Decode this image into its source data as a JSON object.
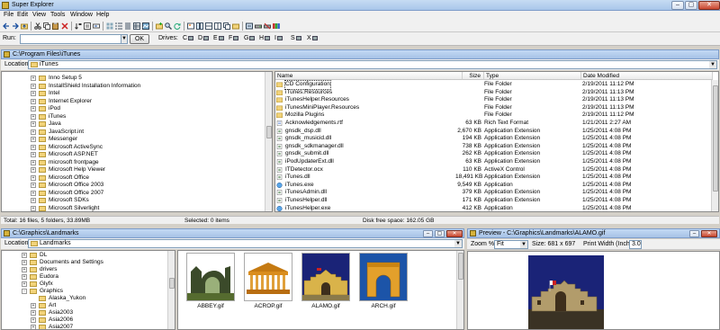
{
  "app": {
    "title": "Super Explorer"
  },
  "menu": [
    "File",
    "Edit",
    "View",
    "Tools",
    "Window",
    "Help"
  ],
  "runbar": {
    "run_label": "Run:",
    "run_value": "",
    "ok_label": "OK",
    "drives_label": "Drives:",
    "drives": [
      "C",
      "D",
      "E",
      "F",
      "G",
      "H",
      "I",
      "S",
      "X"
    ]
  },
  "top_window": {
    "title": "C:\\Program Files\\iTunes",
    "location_label": "Location:",
    "location_value": "iTunes",
    "tree": [
      {
        "label": "Inno Setup 5"
      },
      {
        "label": "InstallShield Installation Information"
      },
      {
        "label": "Intel"
      },
      {
        "label": "Internet Explorer"
      },
      {
        "label": "iPod"
      },
      {
        "label": "iTunes"
      },
      {
        "label": "Java"
      },
      {
        "label": "JavaScript.int"
      },
      {
        "label": "Messenger"
      },
      {
        "label": "Microsoft ActiveSync"
      },
      {
        "label": "Microsoft ASP.NET"
      },
      {
        "label": "microsoft frontpage"
      },
      {
        "label": "Microsoft Help Viewer"
      },
      {
        "label": "Microsoft Office"
      },
      {
        "label": "Microsoft Office 2003"
      },
      {
        "label": "Microsoft Office 2007"
      },
      {
        "label": "Microsoft SDKs"
      },
      {
        "label": "Microsoft Silverlight"
      }
    ],
    "columns": [
      "Name",
      "Size",
      "Type",
      "Date Modified"
    ],
    "files": [
      {
        "name": "CD Configuration",
        "size": "",
        "type": "File Folder",
        "date": "2/19/2011 11:12 PM",
        "kind": "folder"
      },
      {
        "name": "iTunes.Resources",
        "size": "",
        "type": "File Folder",
        "date": "2/19/2011 11:13 PM",
        "kind": "folder"
      },
      {
        "name": "iTunesHelper.Resources",
        "size": "",
        "type": "File Folder",
        "date": "2/19/2011 11:13 PM",
        "kind": "folder"
      },
      {
        "name": "iTunesMiniPlayer.Resources",
        "size": "",
        "type": "File Folder",
        "date": "2/19/2011 11:13 PM",
        "kind": "folder"
      },
      {
        "name": "Mozilla Plugins",
        "size": "",
        "type": "File Folder",
        "date": "2/19/2011 11:12 PM",
        "kind": "folder"
      },
      {
        "name": "Acknowledgements.rtf",
        "size": "63 KB",
        "type": "Rich Text Format",
        "date": "1/21/2011 2:27 AM",
        "kind": "file"
      },
      {
        "name": "gnsdk_dsp.dll",
        "size": "2,670 KB",
        "type": "Application Extension",
        "date": "1/25/2011 4:08 PM",
        "kind": "dll"
      },
      {
        "name": "gnsdk_musicid.dll",
        "size": "194 KB",
        "type": "Application Extension",
        "date": "1/25/2011 4:08 PM",
        "kind": "dll"
      },
      {
        "name": "gnsdk_sdkmanager.dll",
        "size": "738 KB",
        "type": "Application Extension",
        "date": "1/25/2011 4:08 PM",
        "kind": "dll"
      },
      {
        "name": "gnsdk_submit.dll",
        "size": "262 KB",
        "type": "Application Extension",
        "date": "1/25/2011 4:08 PM",
        "kind": "dll"
      },
      {
        "name": "iPodUpdaterExt.dll",
        "size": "63 KB",
        "type": "Application Extension",
        "date": "1/25/2011 4:08 PM",
        "kind": "dll"
      },
      {
        "name": "ITDetector.ocx",
        "size": "110 KB",
        "type": "ActiveX Control",
        "date": "1/25/2011 4:08 PM",
        "kind": "dll"
      },
      {
        "name": "iTunes.dll",
        "size": "18,491 KB",
        "type": "Application Extension",
        "date": "1/25/2011 4:08 PM",
        "kind": "dll"
      },
      {
        "name": "iTunes.exe",
        "size": "9,549 KB",
        "type": "Application",
        "date": "1/25/2011 4:08 PM",
        "kind": "exe"
      },
      {
        "name": "iTunesAdmin.dll",
        "size": "379 KB",
        "type": "Application Extension",
        "date": "1/25/2011 4:08 PM",
        "kind": "dll"
      },
      {
        "name": "iTunesHelper.dll",
        "size": "171 KB",
        "type": "Application Extension",
        "date": "1/25/2011 4:08 PM",
        "kind": "dll"
      },
      {
        "name": "iTunesHelper.exe",
        "size": "412 KB",
        "type": "Application",
        "date": "1/25/2011 4:08 PM",
        "kind": "exe"
      }
    ],
    "status": {
      "total": "Total: 16 files, 5 folders, 33.89MB",
      "selected": "Selected: 0 items",
      "disk": "Disk free space: 162.05 GB"
    }
  },
  "bottom_left_window": {
    "title": "C:\\Graphics\\Landmarks",
    "location_label": "Location:",
    "location_value": "Landmarks",
    "tree": [
      {
        "label": "DL",
        "indent": 1,
        "exp": "+"
      },
      {
        "label": "Documents and Settings",
        "indent": 1,
        "exp": "+"
      },
      {
        "label": "drivers",
        "indent": 1,
        "exp": "+"
      },
      {
        "label": "Eudora",
        "indent": 1,
        "exp": "+"
      },
      {
        "label": "Glyfx",
        "indent": 1,
        "exp": "+"
      },
      {
        "label": "Graphics",
        "indent": 1,
        "exp": "-"
      },
      {
        "label": "Alaska_Yukon",
        "indent": 2,
        "exp": ""
      },
      {
        "label": "Art",
        "indent": 2,
        "exp": "+"
      },
      {
        "label": "Asia2003",
        "indent": 2,
        "exp": "+"
      },
      {
        "label": "Asia2006",
        "indent": 2,
        "exp": "+"
      },
      {
        "label": "Asia2007",
        "indent": 2,
        "exp": "+"
      }
    ],
    "thumbnails": [
      {
        "caption": "ABBEY.gif",
        "art": "abbey"
      },
      {
        "caption": "ACROP.gif",
        "art": "acrop"
      },
      {
        "caption": "ALAMO.gif",
        "art": "alamo"
      },
      {
        "caption": "ARCH.gif",
        "art": "arch"
      }
    ]
  },
  "preview_window": {
    "title": "Preview - C:\\Graphics\\Landmarks\\ALAMO.gif",
    "zoom_label": "Zoom %",
    "zoom_value": "Fit",
    "size_text": "Size: 681 x 697",
    "print_width_label": "Print Width (Inches)",
    "print_width_value": "3.0"
  },
  "colors": {
    "titlebar": "#a9c6ea",
    "folder": "#f2d37a",
    "sky": "#1a2377"
  }
}
